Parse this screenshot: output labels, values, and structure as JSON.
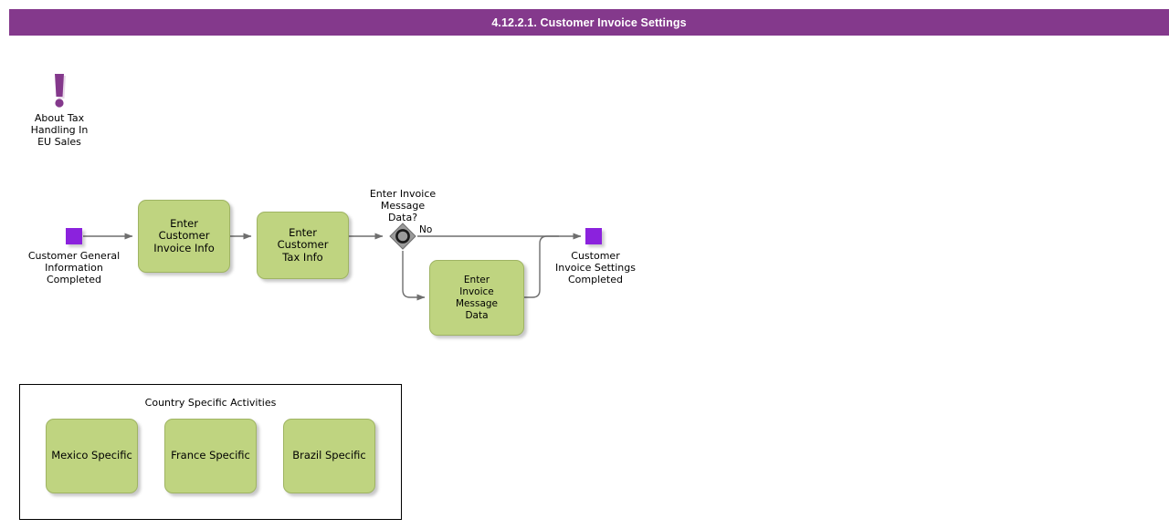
{
  "header": {
    "title": "4.12.2.1. Customer Invoice Settings",
    "bar_color": "#84398C",
    "title_color": "#FFFFFF"
  },
  "palette": {
    "task_fill": "#BFD480",
    "task_stroke": "#9FB463",
    "event_fill": "#8B22DD",
    "gateway_fill": "#9A9A9A",
    "connector": "#6E6E6E",
    "annotation_icon": "#84398C"
  },
  "annotation": {
    "icon": "exclamation-mark-icon",
    "text": "About Tax\nHandling In\nEU Sales"
  },
  "events": [
    {
      "id": "start-event",
      "name": "start-event",
      "type": "start",
      "label": "Customer General\nInformation\nCompleted"
    },
    {
      "id": "end-event",
      "name": "end-event",
      "type": "end",
      "label": "Customer\nInvoice Settings\nCompleted"
    }
  ],
  "gateway": {
    "id": "gateway-invoice-message",
    "type": "event-based",
    "label": "Enter Invoice\nMessage\nData?"
  },
  "flow_labels": {
    "no": "No"
  },
  "tasks": [
    {
      "id": "task-enter-customer-invoice-info",
      "label": "Enter Customer\nInvoice Info"
    },
    {
      "id": "task-enter-customer-tax-info",
      "label": "Enter Customer\nTax Info"
    },
    {
      "id": "task-enter-invoice-message-data",
      "label": "Enter\nInvoice\nMessage\nData"
    }
  ],
  "group": {
    "title": "Country Specific Activities",
    "tasks": [
      {
        "id": "task-mexico-specific",
        "label": "Mexico Specific"
      },
      {
        "id": "task-france-specific",
        "label": "France Specific"
      },
      {
        "id": "task-brazil-specific",
        "label": "Brazil Specific"
      }
    ]
  }
}
